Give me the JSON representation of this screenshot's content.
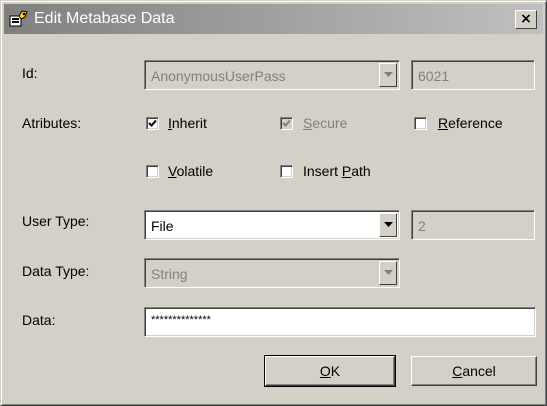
{
  "window": {
    "title": "Edit Metabase Data",
    "close_label": "×"
  },
  "id_row": {
    "label": "Id:",
    "combo_value": "AnonymousUserPass",
    "number": "6021"
  },
  "attributes": {
    "label": "Atributes:",
    "inherit": {
      "key": "I",
      "rest": "nherit",
      "checked": true
    },
    "secure": {
      "key": "S",
      "rest": "ecure",
      "checked": true,
      "disabled": true
    },
    "reference": {
      "key": "R",
      "rest": "eference",
      "checked": false
    },
    "volatile": {
      "key": "V",
      "rest": "olatile",
      "checked": false
    },
    "insert_path": {
      "pre": "Insert ",
      "key": "P",
      "rest": "ath",
      "checked": false
    }
  },
  "user_type": {
    "label": "User Type:",
    "value": "File",
    "number": "2"
  },
  "data_type": {
    "label": "Data Type:",
    "value": "String"
  },
  "data": {
    "label": "Data:",
    "value": "**************"
  },
  "buttons": {
    "ok": {
      "key": "O",
      "rest": "K"
    },
    "cancel": {
      "key": "C",
      "rest": "ancel"
    }
  }
}
